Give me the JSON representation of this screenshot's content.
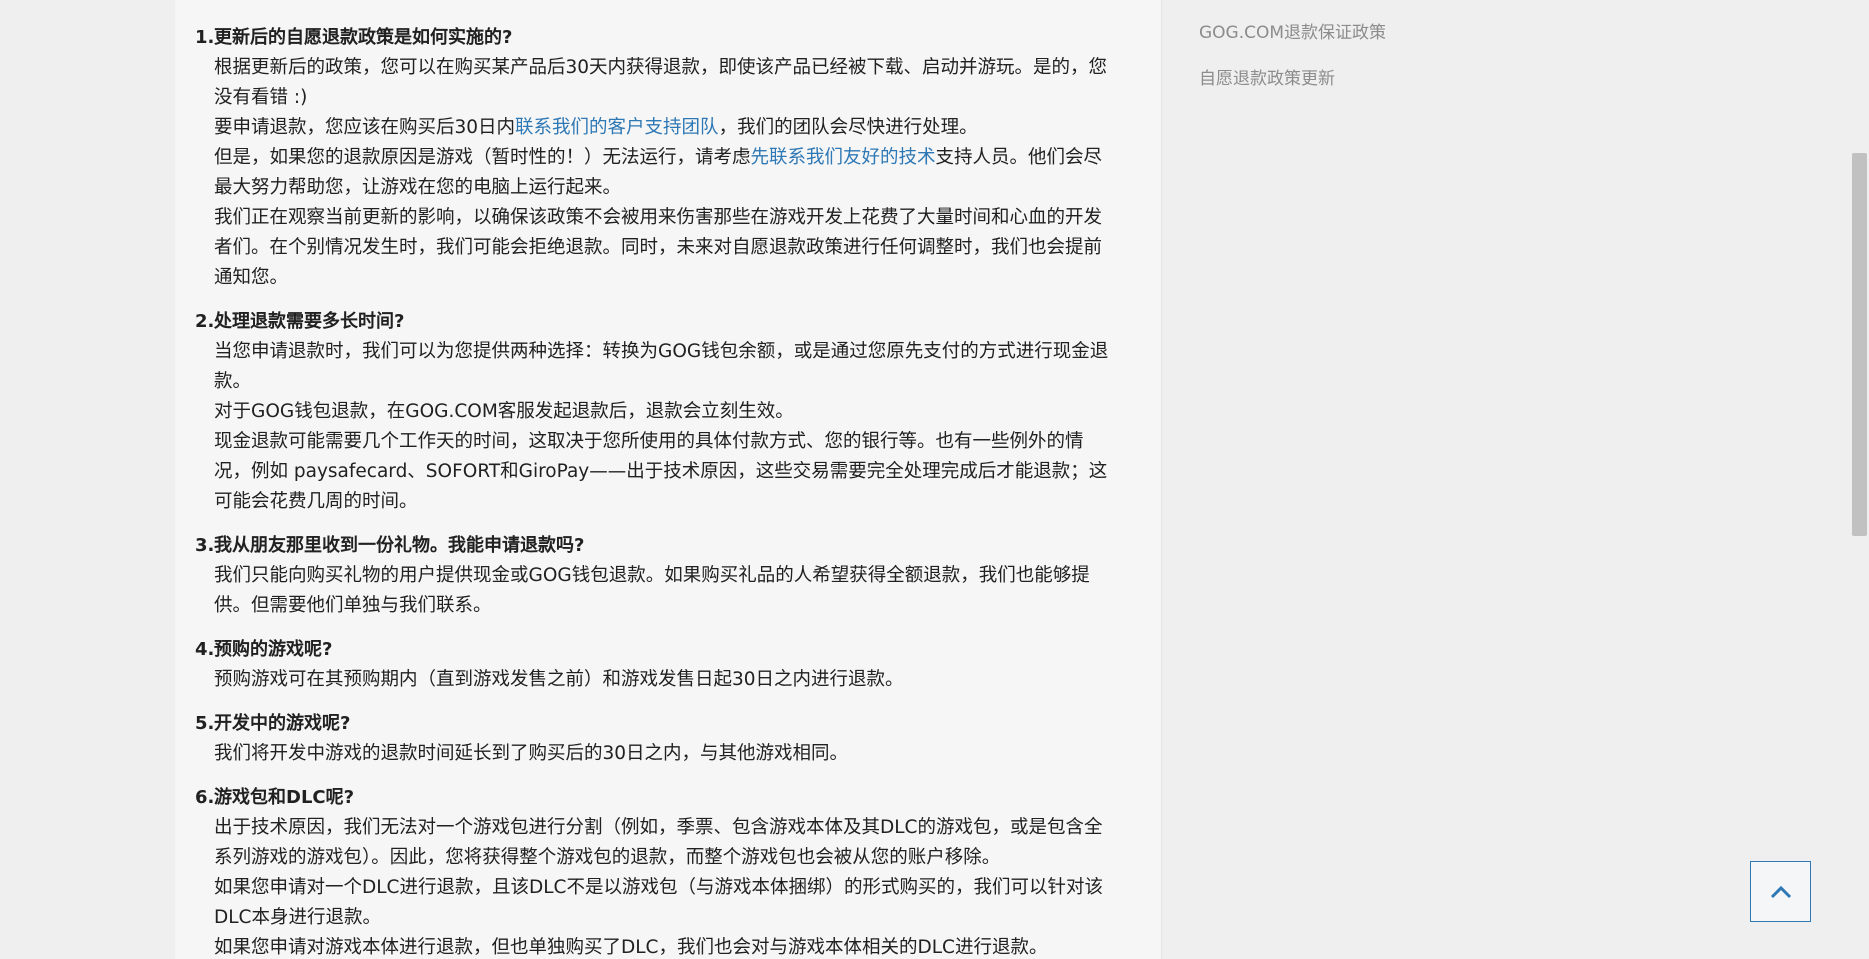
{
  "faq": [
    {
      "num": "1.",
      "question": "更新后的自愿退款政策是如何实施的?",
      "paragraphs": [
        {
          "pre": "根据更新后的政策，您可以在购买某产品后30天内获得退款，即使该产品已经被下载、启动并游玩。是的，您没有看错 :)"
        },
        {
          "pre": "要申请退款，您应该在购买后30日内",
          "link": "联系我们的客户支持团队",
          "post": "，我们的团队会尽快进行处理。"
        },
        {
          "pre": "但是，如果您的退款原因是游戏（暂时性的！）无法运行，请考虑",
          "link": "先联系我们友好的技术",
          "post": "支持人员。他们会尽最大努力帮助您，让游戏在您的电脑上运行起来。"
        },
        {
          "pre": "我们正在观察当前更新的影响，以确保该政策不会被用来伤害那些在游戏开发上花费了大量时间和心血的开发者们。在个别情况发生时，我们可能会拒绝退款。同时，未来对自愿退款政策进行任何调整时，我们也会提前通知您。"
        }
      ]
    },
    {
      "num": "2.",
      "question": "处理退款需要多长时间?",
      "paragraphs": [
        {
          "pre": "当您申请退款时，我们可以为您提供两种选择：转换为GOG钱包余额，或是通过您原先支付的方式进行现金退款。"
        },
        {
          "pre": "对于GOG钱包退款，在GOG.COM客服发起退款后，退款会立刻生效。"
        },
        {
          "pre": "现金退款可能需要几个工作天的时间，这取决于您所使用的具体付款方式、您的银行等。也有一些例外的情况，例如 paysafecard、SOFORT和GiroPay——出于技术原因，这些交易需要完全处理完成后才能退款；这可能会花费几周的时间。"
        }
      ]
    },
    {
      "num": "3.",
      "question": "我从朋友那里收到一份礼物。我能申请退款吗?",
      "paragraphs": [
        {
          "pre": "我们只能向购买礼物的用户提供现金或GOG钱包退款。如果购买礼品的人希望获得全额退款，我们也能够提供。但需要他们单独与我们联系。"
        }
      ]
    },
    {
      "num": "4.",
      "question": "预购的游戏呢?",
      "paragraphs": [
        {
          "pre": "预购游戏可在其预购期内（直到游戏发售之前）和游戏发售日起30日之内进行退款。"
        }
      ]
    },
    {
      "num": "5.",
      "question": "开发中的游戏呢?",
      "paragraphs": [
        {
          "pre": "我们将开发中游戏的退款时间延长到了购买后的30日之内，与其他游戏相同。"
        }
      ]
    },
    {
      "num": "6.",
      "question": "游戏包和DLC呢?",
      "paragraphs": [
        {
          "pre": "出于技术原因，我们无法对一个游戏包进行分割（例如，季票、包含游戏本体及其DLC的游戏包，或是包含全系列游戏的游戏包）。因此，您将获得整个游戏包的退款，而整个游戏包也会被从您的账户移除。"
        },
        {
          "pre": "如果您申请对一个DLC进行退款，且该DLC不是以游戏包（与游戏本体捆绑）的形式购买的，我们可以针对该DLC本身进行退款。"
        },
        {
          "pre": "如果您申请对游戏本体进行退款，但也单独购买了DLC，我们也会对与游戏本体相关的DLC进行退款。"
        }
      ]
    }
  ],
  "sidebar": {
    "links": [
      "GOG.COM退款保证政策",
      "自愿退款政策更新"
    ]
  },
  "scroll_top": {
    "icon": "chevron-up-icon"
  },
  "colors": {
    "link": "#2e78b5",
    "sidebar_link": "#8c8c8c",
    "panel": "#f6f6f6",
    "page": "#efefef"
  }
}
